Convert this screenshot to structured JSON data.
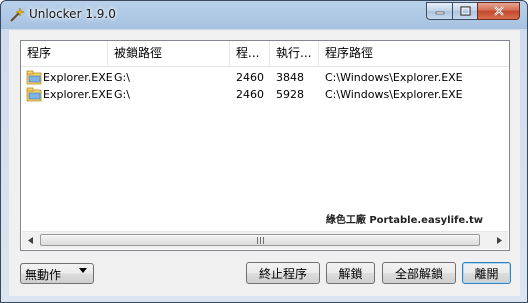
{
  "window": {
    "title": "Unlocker 1.9.0"
  },
  "list": {
    "columns": [
      "程序",
      "被鎖路徑",
      "程...",
      "執行...",
      "程序路徑"
    ],
    "rows": [
      {
        "process": "Explorer.EXE",
        "locked_path": "G:\\",
        "pid": "2460",
        "handle": "3848",
        "process_path": "C:\\Windows\\Explorer.EXE",
        "icon": "explorer-icon"
      },
      {
        "process": "Explorer.EXE",
        "locked_path": "G:\\",
        "pid": "2460",
        "handle": "5928",
        "process_path": "C:\\Windows\\Explorer.EXE",
        "icon": "explorer-icon"
      }
    ]
  },
  "watermark": "綠色工廠 Portable.easylife.tw",
  "action_select": {
    "value": "無動作"
  },
  "buttons": {
    "kill_process": "終止程序",
    "unlock": "解鎖",
    "unlock_all": "全部解鎖",
    "close": "離開"
  },
  "colors": {
    "accent": "#3c7fb1",
    "close_button": "#c2482c"
  }
}
